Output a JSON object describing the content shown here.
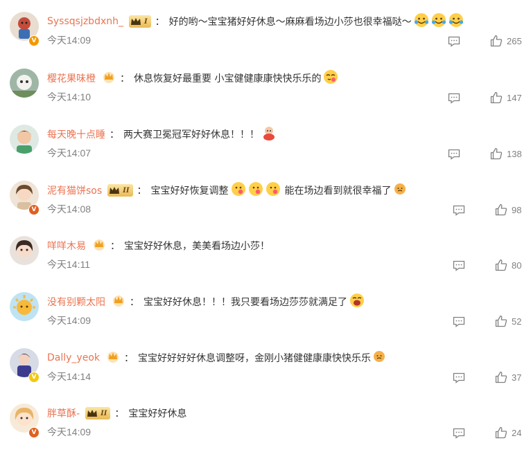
{
  "comments": [
    {
      "username": "Syssqsjzbdxnh_",
      "text": "好的哟～宝宝猪好好休息～麻麻看场边小莎也很幸福哒～",
      "time": "今天14:09",
      "likes": "265",
      "badge": "level-crown-I",
      "level_label": "I",
      "verified": "V",
      "verified_color": "#f39800",
      "emojis": [
        "emoji-icon",
        "emoji-icon",
        "emoji-icon"
      ]
    },
    {
      "username": "樱花果味橙",
      "text": "休息恢复好最重要 小宝健健康康快快乐乐的",
      "time": "今天14:10",
      "likes": "147",
      "badge": "fan-crown"
    },
    {
      "username": "每天晚十点睡",
      "text": "两大赛卫冕冠军好好休息！！！",
      "time": "今天14:07",
      "likes": "138"
    },
    {
      "username": "泥有猫饼sos",
      "text": "宝宝好好恢复调整",
      "text2": "能在场边看到就很幸福了",
      "time": "今天14:08",
      "likes": "98",
      "badge": "level-crown-II",
      "level_label": "II",
      "verified": "V",
      "verified_color": "#e0601f"
    },
    {
      "username": "咩咩木易",
      "text": "宝宝好好休息，美美看场边小莎！",
      "time": "今天14:11",
      "likes": "80",
      "badge": "fan-crown"
    },
    {
      "username": "没有别颗太阳",
      "text": "宝宝好好休息！！！我只要看场边莎莎就满足了",
      "time": "今天14:09",
      "likes": "52",
      "badge": "fan-crown"
    },
    {
      "username": "Dally_yeok",
      "text": "宝宝好好好好休息调整呀，金刚小猪健健康康快快乐乐",
      "time": "今天14:14",
      "likes": "37",
      "badge": "fan-crown",
      "verified": "V",
      "verified_color": "#f2c811"
    },
    {
      "username": "胖草酥-",
      "text": "宝宝好好休息",
      "time": "今天14:09",
      "likes": "24",
      "badge": "level-crown-II",
      "level_label": "II",
      "verified": "V",
      "verified_color": "#e0601f"
    }
  ],
  "separator": "：",
  "icons": {
    "reply": "comment-icon",
    "like": "thumbs-up-icon"
  },
  "colors": {
    "username": "#eb7350",
    "meta": "#808080",
    "text": "#333333"
  }
}
